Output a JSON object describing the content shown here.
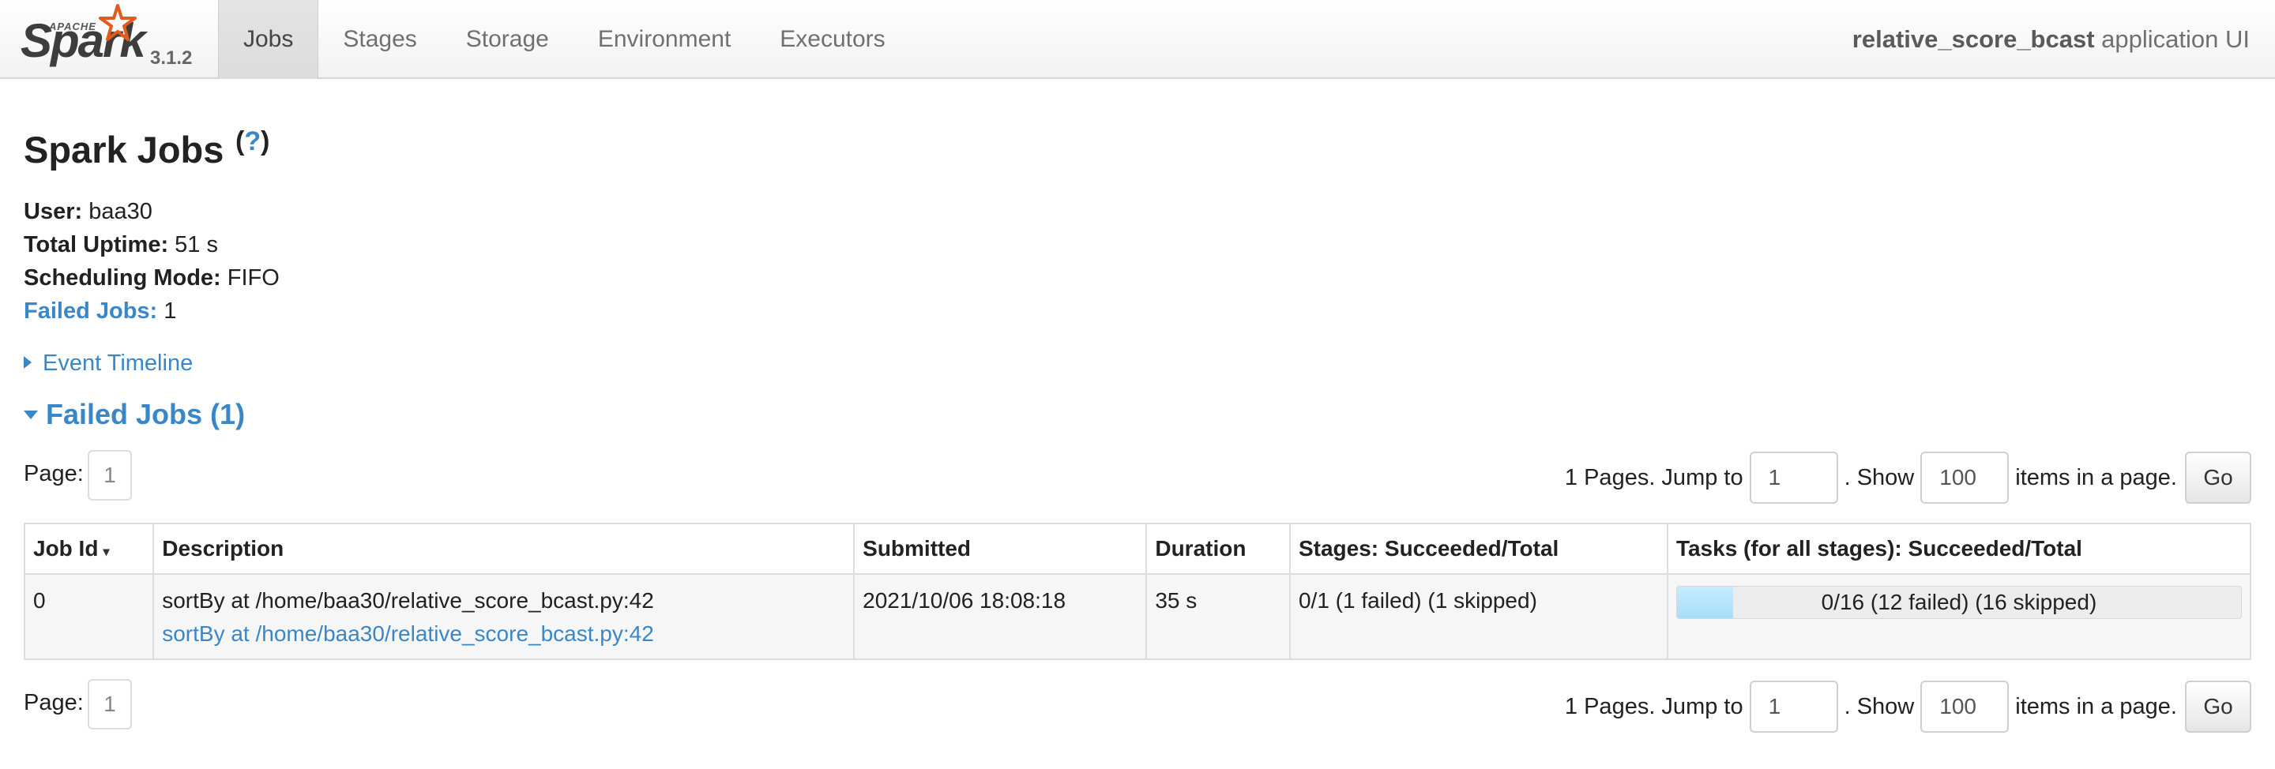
{
  "brand": {
    "apache": "APACHE",
    "name": "Spark",
    "version": "3.1.2"
  },
  "nav": {
    "tabs": [
      {
        "label": "Jobs",
        "active": true
      },
      {
        "label": "Stages"
      },
      {
        "label": "Storage"
      },
      {
        "label": "Environment"
      },
      {
        "label": "Executors"
      }
    ],
    "app_name": "relative_score_bcast",
    "app_suffix": " application UI"
  },
  "header": {
    "title": "Spark Jobs",
    "help_open": "(",
    "help_q": "?",
    "help_close": ")"
  },
  "summary": {
    "user_label": "User:",
    "user_value": " baa30",
    "uptime_label": "Total Uptime:",
    "uptime_value": " 51 s",
    "mode_label": "Scheduling Mode:",
    "mode_value": " FIFO",
    "failed_label": "Failed Jobs:",
    "failed_value": " 1"
  },
  "event_timeline": "Event Timeline",
  "failed_section": "Failed Jobs (1)",
  "pager": {
    "page_label": "Page:",
    "current_page": "1",
    "pages_text": "1 Pages. Jump to",
    "jump_value": "1",
    "show_text": ". Show",
    "show_value": "100",
    "items_text": "items in a page.",
    "go_label": "Go"
  },
  "table": {
    "headers": [
      "Job Id",
      "Description",
      "Submitted",
      "Duration",
      "Stages: Succeeded/Total",
      "Tasks (for all stages): Succeeded/Total"
    ],
    "sort_indicator": "▾",
    "rows": [
      {
        "job_id": "0",
        "desc_text": "sortBy at /home/baa30/relative_score_bcast.py:42",
        "desc_link": "sortBy at /home/baa30/relative_score_bcast.py:42",
        "submitted": "2021/10/06 18:08:18",
        "duration": "35 s",
        "stages": "0/1 (1 failed) (1 skipped)",
        "tasks": "0/16 (12 failed) (16 skipped)",
        "task_progress_fraction": 0.1
      }
    ]
  },
  "colors": {
    "link": "#3a87c8",
    "progress": "#a8ddf8"
  }
}
